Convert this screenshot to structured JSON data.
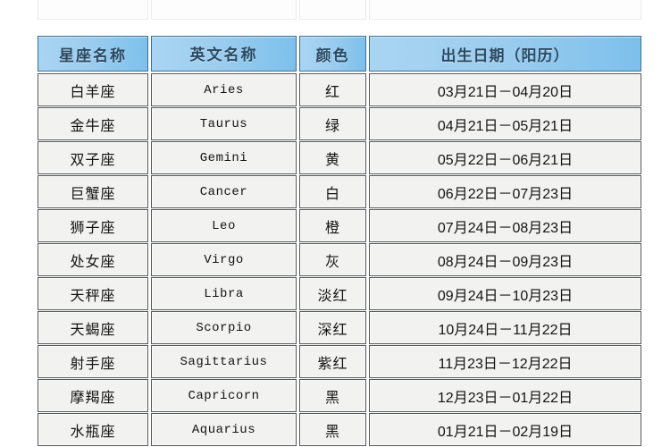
{
  "table": {
    "headers": {
      "name": "星座名称",
      "english": "英文名称",
      "color": "颜色",
      "birthdate": "出生日期（阳历）"
    },
    "rows": [
      {
        "name": "白羊座",
        "english": "Aries",
        "color": "红",
        "birthdate": "03月21日－04月20日"
      },
      {
        "name": "金牛座",
        "english": "Taurus",
        "color": "绿",
        "birthdate": "04月21日－05月21日"
      },
      {
        "name": "双子座",
        "english": "Gemini",
        "color": "黄",
        "birthdate": "05月22日－06月21日"
      },
      {
        "name": "巨蟹座",
        "english": "Cancer",
        "color": "白",
        "birthdate": "06月22日－07月23日"
      },
      {
        "name": "狮子座",
        "english": "Leo",
        "color": "橙",
        "birthdate": "07月24日－08月23日"
      },
      {
        "name": "处女座",
        "english": "Virgo",
        "color": "灰",
        "birthdate": "08月24日－09月23日"
      },
      {
        "name": "天秤座",
        "english": "Libra",
        "color": "淡红",
        "birthdate": "09月24日－10月23日"
      },
      {
        "name": "天蝎座",
        "english": "Scorpio",
        "color": "深红",
        "birthdate": "10月24日－11月22日"
      },
      {
        "name": "射手座",
        "english": "Sagittarius",
        "color": "紫红",
        "birthdate": "11月23日－12月22日"
      },
      {
        "name": "摩羯座",
        "english": "Capricorn",
        "color": "黑",
        "birthdate": "12月23日－01月22日"
      },
      {
        "name": "水瓶座",
        "english": "Aquarius",
        "color": "黑",
        "birthdate": "01月21日－02月19日"
      }
    ]
  },
  "colors": {
    "header_blue": "#9dcdee",
    "header_blue_edge": "#7dc0ec",
    "header_text": "#2b4a63",
    "cell_background": "#f2f2f0",
    "cell_border": "#55585a",
    "page_background": "#ffffff"
  }
}
